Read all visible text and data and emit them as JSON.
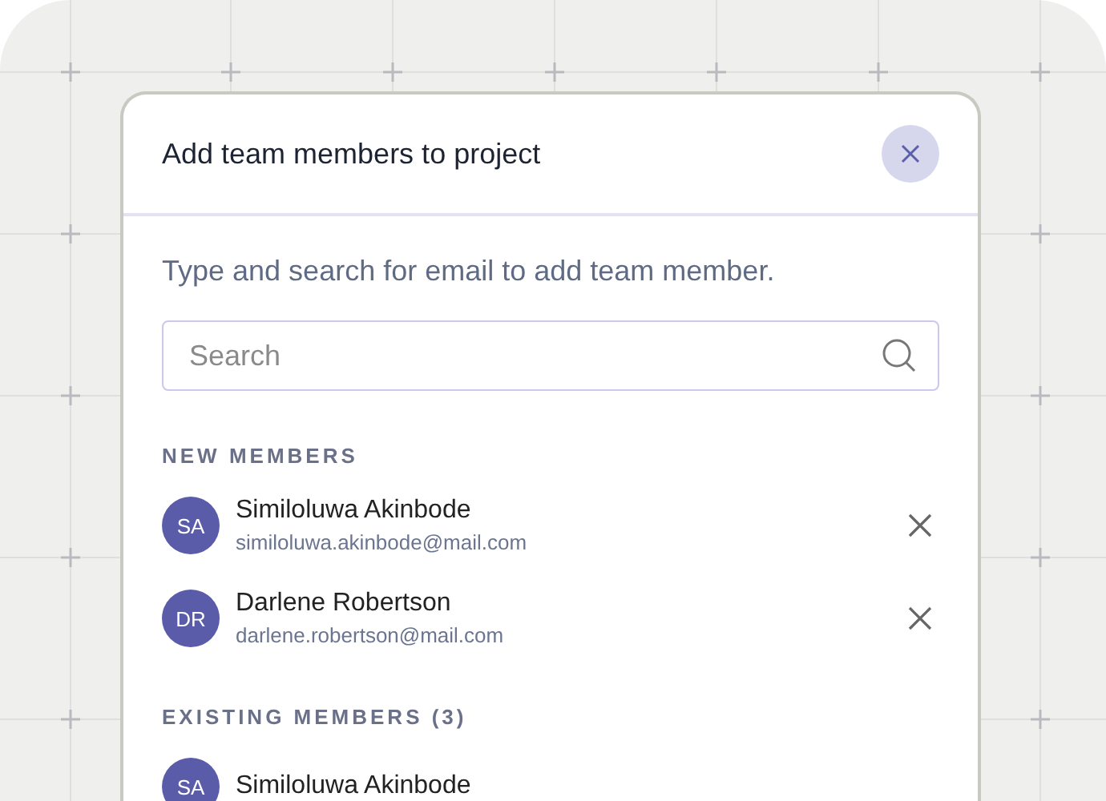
{
  "dialog": {
    "title": "Add team members to project",
    "description": "Type and search for email to add team member.",
    "search": {
      "placeholder": "Search"
    },
    "sections": [
      {
        "label": "NEW MEMBERS",
        "members": [
          {
            "initials": "SA",
            "name": "Similoluwa Akinbode",
            "email": "similoluwa.akinbode@mail.com",
            "removable": true
          },
          {
            "initials": "DR",
            "name": "Darlene Robertson",
            "email": "darlene.robertson@mail.com",
            "removable": true
          }
        ]
      },
      {
        "label": "EXISTING MEMBERS (3)",
        "members": [
          {
            "initials": "SA",
            "name": "Similoluwa Akinbode",
            "removable": false
          }
        ]
      }
    ]
  }
}
